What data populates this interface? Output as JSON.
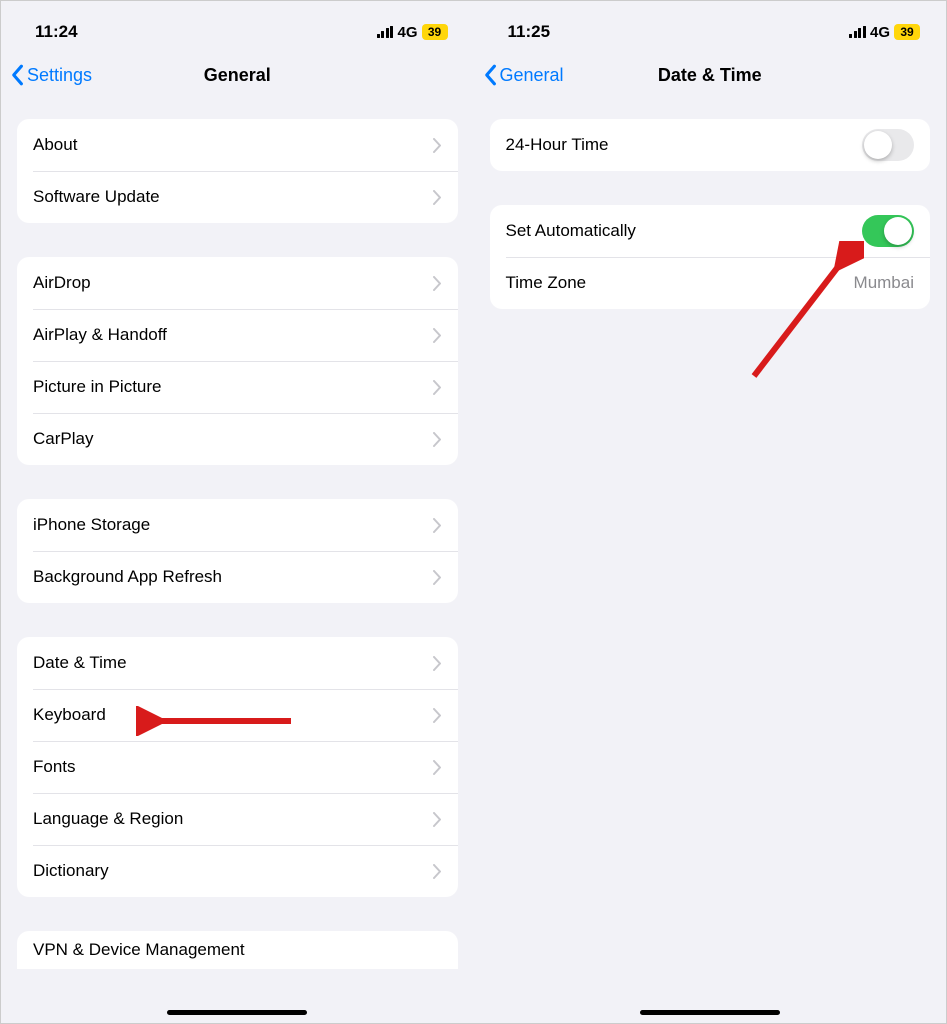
{
  "left": {
    "status": {
      "time": "11:24",
      "network": "4G",
      "battery": "39"
    },
    "nav": {
      "back": "Settings",
      "title": "General"
    },
    "groups": [
      [
        {
          "label": "About"
        },
        {
          "label": "Software Update"
        }
      ],
      [
        {
          "label": "AirDrop"
        },
        {
          "label": "AirPlay & Handoff"
        },
        {
          "label": "Picture in Picture"
        },
        {
          "label": "CarPlay"
        }
      ],
      [
        {
          "label": "iPhone Storage"
        },
        {
          "label": "Background App Refresh"
        }
      ],
      [
        {
          "label": "Date & Time"
        },
        {
          "label": "Keyboard"
        },
        {
          "label": "Fonts"
        },
        {
          "label": "Language & Region"
        },
        {
          "label": "Dictionary"
        }
      ]
    ],
    "partial": {
      "label": "VPN & Device Management"
    }
  },
  "right": {
    "status": {
      "time": "11:25",
      "network": "4G",
      "battery": "39"
    },
    "nav": {
      "back": "General",
      "title": "Date & Time"
    },
    "items": {
      "twentyFourHour": {
        "label": "24-Hour Time",
        "on": false
      },
      "setAuto": {
        "label": "Set Automatically",
        "on": true
      },
      "timeZone": {
        "label": "Time Zone",
        "value": "Mumbai"
      }
    }
  }
}
